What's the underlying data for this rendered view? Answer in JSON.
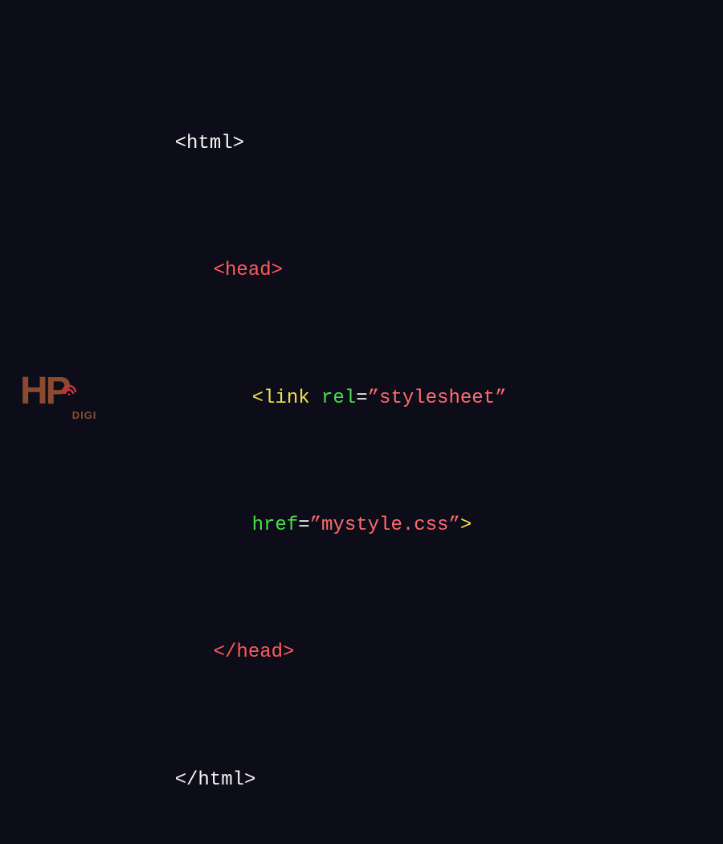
{
  "code": {
    "line1": {
      "html_open": "<html>"
    },
    "line2": {
      "head_open": "<head>"
    },
    "line3": {
      "link_open": "<link",
      "rel_attr": " rel",
      "eq1": "=",
      "rel_val": "”stylesheet”"
    },
    "line4": {
      "href_attr": "href",
      "eq2": "=",
      "href_val": "”mystyle.css”",
      "close": ">"
    },
    "line5": {
      "head_close": "</head>"
    },
    "line6": {
      "html_close": "</html>"
    }
  },
  "logo": {
    "brand_main": "HP",
    "brand_sub": "DIGI"
  }
}
